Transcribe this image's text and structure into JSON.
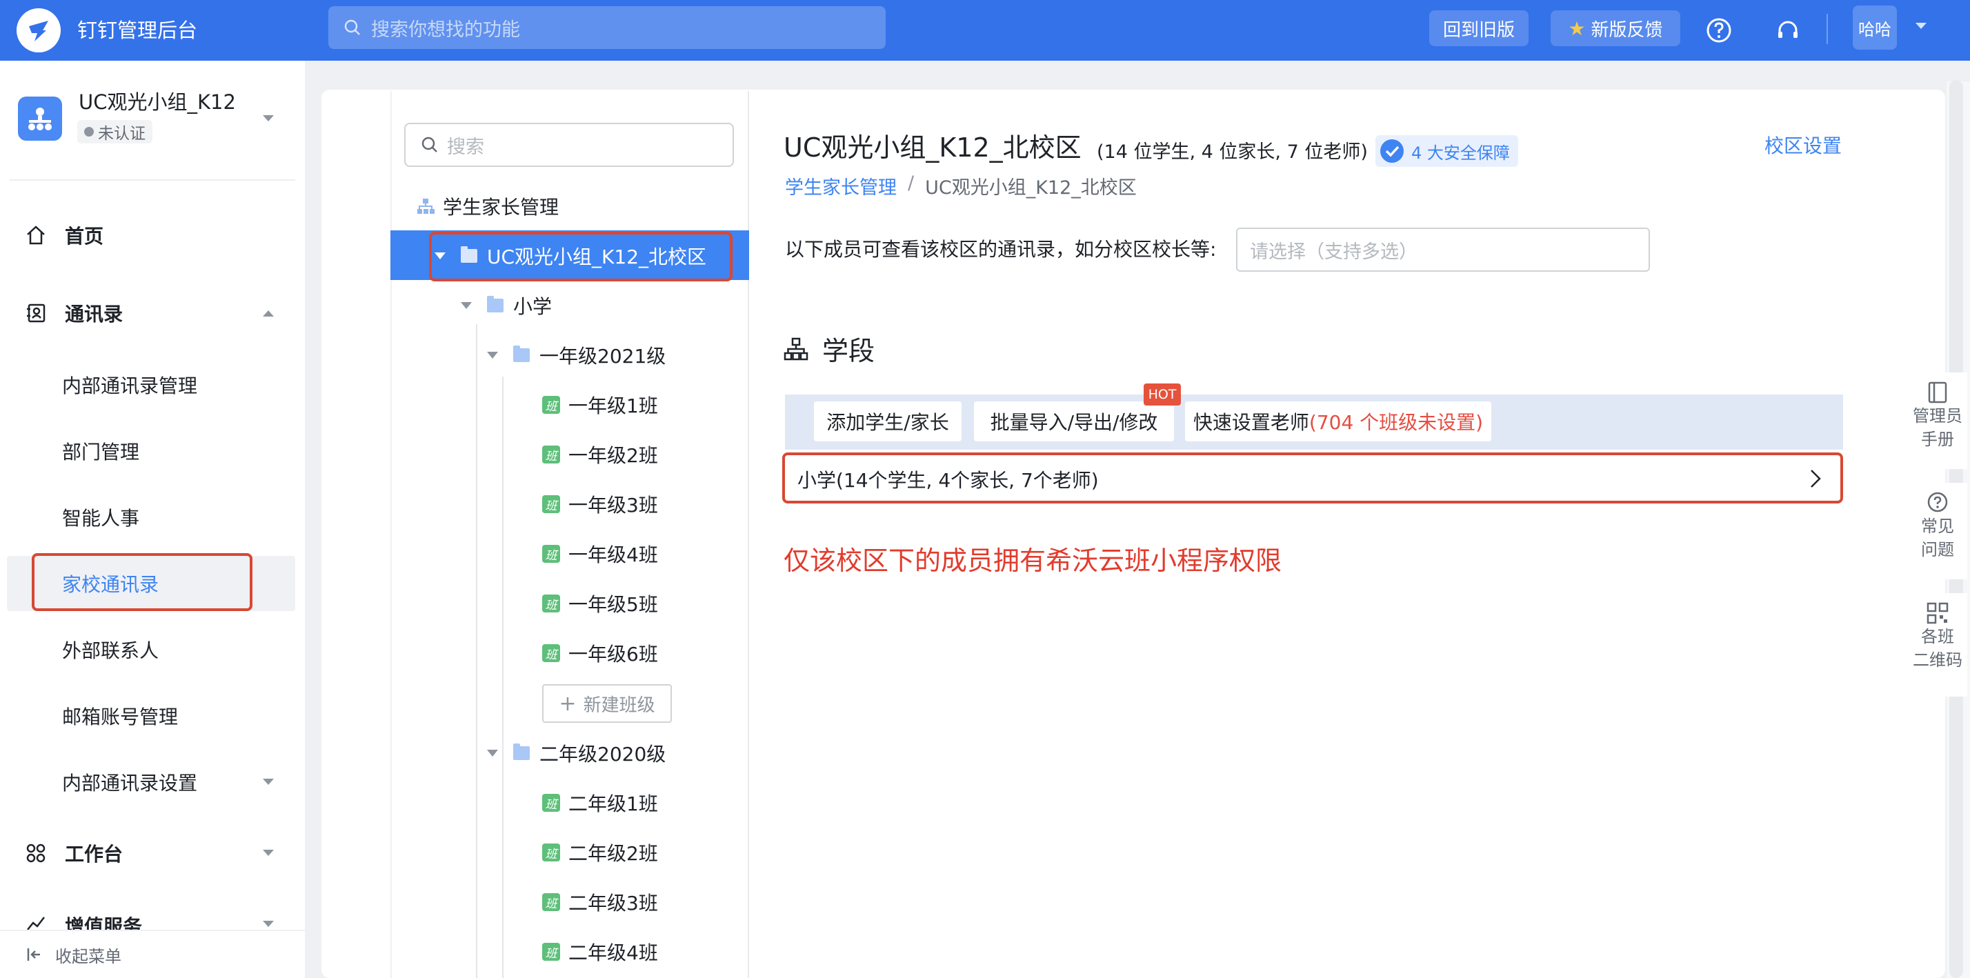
{
  "app": {
    "title": "钉钉管理后台"
  },
  "topbar": {
    "search_placeholder": "搜索你想找的功能",
    "back_to_old": "回到旧版",
    "feedback": "新版反馈",
    "user": "哈哈"
  },
  "sidebar": {
    "org_name": "UC观光小组_K12",
    "org_status": "未认证",
    "items": {
      "home": "首页",
      "contacts": "通讯录",
      "internal_contacts": "内部通讯录管理",
      "department": "部门管理",
      "smart_hr": "智能人事",
      "family_school": "家校通讯录",
      "external": "外部联系人",
      "mailbox": "邮箱账号管理",
      "contacts_settings": "内部通讯录设置",
      "workbench": "工作台",
      "value_added": "增值服务"
    },
    "collapse": "收起菜单",
    "active": "家校通讯录"
  },
  "tree": {
    "search_placeholder": "搜索",
    "root": "学生家长管理",
    "campus": "UC观光小组_K12_北校区",
    "stage": "小学",
    "grades": [
      {
        "name": "一年级2021级",
        "classes": [
          "一年级1班",
          "一年级2班",
          "一年级3班",
          "一年级4班",
          "一年级5班",
          "一年级6班"
        ]
      },
      {
        "name": "二年级2020级",
        "classes": [
          "二年级1班",
          "二年级2班",
          "二年级3班",
          "二年级4班"
        ]
      }
    ],
    "class_tag": "班",
    "new_class": "新建班级"
  },
  "main": {
    "title": "UC观光小组_K12_北校区",
    "stats": "(14 位学生, 4 位家长, 7 位老师)",
    "safety_tag": "4 大安全保障",
    "campus_settings": "校区设置",
    "breadcrumb": [
      "学生家长管理",
      "UC观光小组_K12_北校区"
    ],
    "breadcrumb_sep": "/",
    "viewers_label": "以下成员可查看该校区的通讯录，如分校区校长等:",
    "viewers_placeholder": "请选择（支持多选）",
    "section_title": "学段",
    "actions": {
      "add": "添加学生/家长",
      "import": "批量导入/导出/修改",
      "hot": "HOT",
      "quick_prefix": "快速设置老师",
      "quick_warn": "(704 个班级未设置)"
    },
    "stage_row": "小学(14个学生, 4个家长, 7个老师)",
    "note": "仅该校区下的成员拥有希沃云班小程序权限"
  },
  "rail": {
    "manual": [
      "管理员",
      "手册"
    ],
    "faq": [
      "常见",
      "问题"
    ],
    "qr": [
      "各班",
      "二维码"
    ]
  },
  "colors": {
    "brand": "#3472ea",
    "selected": "#3e84f2",
    "highlight": "#d84833",
    "note": "#e13c2d",
    "warn": "#e54d42"
  }
}
